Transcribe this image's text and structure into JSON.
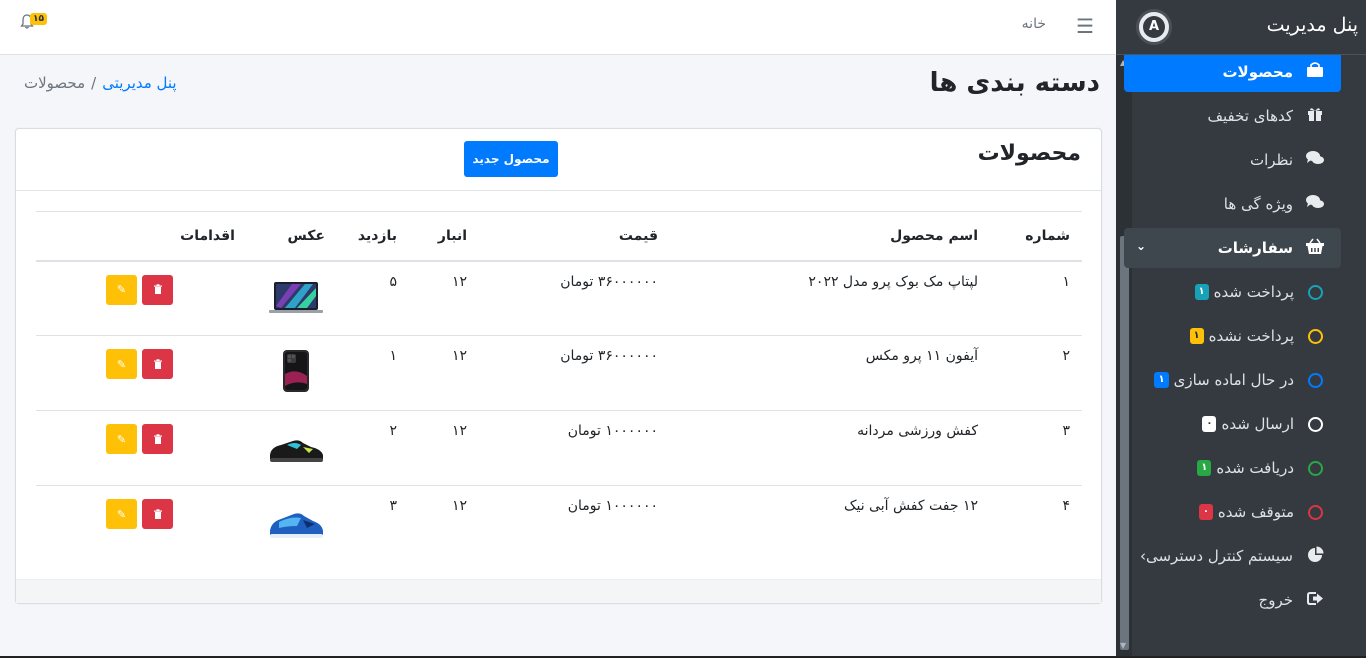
{
  "sidebar": {
    "brand": "پنل مدیریت",
    "items": [
      {
        "label": "محصولات",
        "icon": "shopping-bag-icon",
        "glyph": "🛍",
        "active": true
      },
      {
        "label": "کدهای تخفیف",
        "icon": "gift-icon",
        "glyph": "🎁"
      },
      {
        "label": "نظرات",
        "icon": "comments-icon",
        "glyph": "💬"
      },
      {
        "label": "ویژه گی ها",
        "icon": "comments-icon",
        "glyph": "💬"
      },
      {
        "label": "سفارشات",
        "icon": "basket-icon",
        "glyph": "🧺",
        "open": true
      }
    ],
    "orders": [
      {
        "label": "پرداخت شده",
        "count": "۱",
        "color": "#17a2b8"
      },
      {
        "label": "پرداخت نشده",
        "count": "۱",
        "color": "#ffc107"
      },
      {
        "label": "در حال اماده سازی",
        "count": "۱",
        "color": "#007bff"
      },
      {
        "label": "ارسال شده",
        "count": "۰",
        "color": "#ffffff"
      },
      {
        "label": "دریافت شده",
        "count": "۱",
        "color": "#28a745"
      },
      {
        "label": "متوقف شده",
        "count": "۰",
        "color": "#dc3545"
      }
    ],
    "access_control": "سیستم کنترل دسترسی›",
    "logout": "خروج"
  },
  "topbar": {
    "home": "خانه",
    "notifications": "۱۵"
  },
  "header": {
    "title": "دسته بندی ها",
    "breadcrumb_link": "پنل مدیریتی",
    "breadcrumb_sep": "/",
    "breadcrumb_current": "محصولات"
  },
  "card": {
    "title": "محصولات",
    "new_button": "محصول جدید"
  },
  "table": {
    "headers": {
      "id": "شماره",
      "name": "اسم محصول",
      "price": "قیمت",
      "stock": "انبار",
      "views": "بازدید",
      "image": "عکس",
      "actions": "اقدامات"
    },
    "rows": [
      {
        "id": "۱",
        "name": "لپتاپ مک بوک پرو مدل ۲۰۲۲",
        "price": "۳۶۰۰۰۰۰۰ تومان",
        "stock": "۱۲",
        "views": "۵",
        "image": "laptop"
      },
      {
        "id": "۲",
        "name": "آیفون ۱۱ پرو مکس",
        "price": "۳۶۰۰۰۰۰۰ تومان",
        "stock": "۱۲",
        "views": "۱",
        "image": "phone"
      },
      {
        "id": "۳",
        "name": "کفش ورزشی مردانه",
        "price": "۱۰۰۰۰۰۰ تومان",
        "stock": "۱۲",
        "views": "۲",
        "image": "shoe-black"
      },
      {
        "id": "۴",
        "name": "۱۲ جفت کفش آبی نیک",
        "price": "۱۰۰۰۰۰۰ تومان",
        "stock": "۱۲",
        "views": "۳",
        "image": "shoe-blue"
      }
    ]
  },
  "colors": {
    "primary": "#007bff",
    "sidebar_bg": "#343a40",
    "warning": "#ffc107",
    "danger": "#dc3545"
  }
}
